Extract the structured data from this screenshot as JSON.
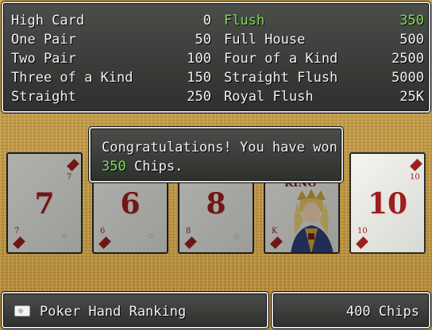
{
  "ranking": {
    "left": [
      {
        "name": "High Card",
        "payout": "0"
      },
      {
        "name": "One Pair",
        "payout": "50"
      },
      {
        "name": "Two Pair",
        "payout": "100"
      },
      {
        "name": "Three of a Kind",
        "payout": "150"
      },
      {
        "name": "Straight",
        "payout": "250"
      }
    ],
    "right": [
      {
        "name": "Flush",
        "payout": "350"
      },
      {
        "name": "Full House",
        "payout": "500"
      },
      {
        "name": "Four of a Kind",
        "payout": "2500"
      },
      {
        "name": "Straight Flush",
        "payout": "5000"
      },
      {
        "name": "Royal Flush",
        "payout": "25K"
      }
    ],
    "highlight_color": "#7fe05a"
  },
  "cards": [
    {
      "rank": "7",
      "suit": "diamonds"
    },
    {
      "rank": "6",
      "suit": "diamonds"
    },
    {
      "rank": "8",
      "suit": "diamonds"
    },
    {
      "rank": "K",
      "face_text": "KING",
      "suit": "diamonds"
    },
    {
      "rank": "10",
      "suit": "diamonds"
    }
  ],
  "message": {
    "line1": "Congratulations! You have won",
    "amount": "350",
    "tail": "Chips."
  },
  "footer": {
    "label": "Poker Hand Ranking",
    "icon": "card-icon",
    "chips": "400 Chips"
  }
}
